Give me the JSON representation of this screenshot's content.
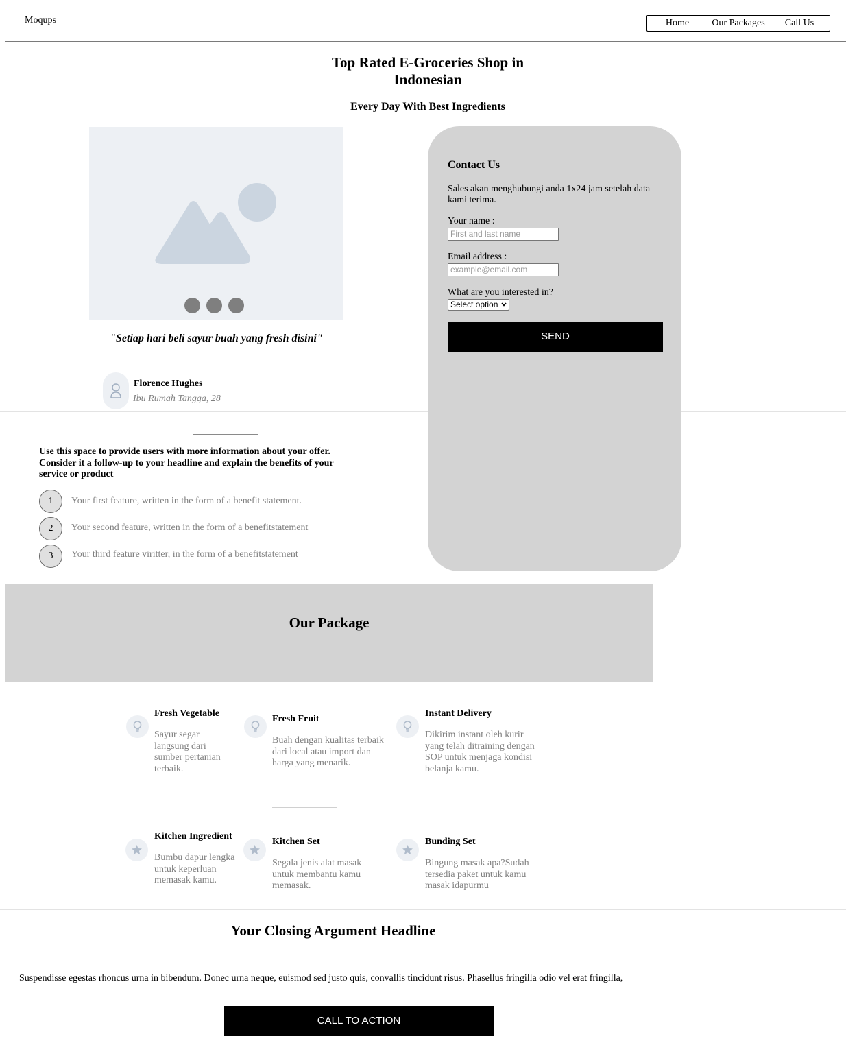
{
  "header": {
    "logo": "Moqups",
    "nav": [
      "Home",
      "Our Packages",
      "Call Us"
    ]
  },
  "hero": {
    "title_line1": "Top Rated E-Groceries Shop in",
    "title_line2": "Indonesian",
    "subtitle": "Every Day With Best Ingredients"
  },
  "testimonial": {
    "image_icon": "image-placeholder-icon",
    "quote": "\"Setiap hari beli sayur buah yang fresh disini\"",
    "name": "Florence Hughes",
    "role": "Ibu Rumah Tangga, 28",
    "avatar_icon": "user-icon"
  },
  "offer": {
    "text": "Use this space to provide users with more information about your offer. Consider it a follow-up to your headline and explain the benefits of your service or product",
    "features": [
      {
        "num": "1",
        "text": "Your first feature, written in the form of a benefit statement."
      },
      {
        "num": "2",
        "text": "Your second feature, written in the form of a benefitstatement"
      },
      {
        "num": "3",
        "text": "Your third feature viritter, in the form of a benefitstatement"
      }
    ]
  },
  "contact": {
    "title": "Contact Us",
    "desc": "Sales akan menghubungi anda 1x24 jam setelah data kami terima.",
    "name_label": "Your name :",
    "name_placeholder": "First and last name",
    "email_label": "Email address :",
    "email_placeholder": "example@email.com",
    "interest_label": "What are you interested in?",
    "interest_selected": "Select option",
    "send": "SEND"
  },
  "packages": {
    "title": "Our Package",
    "row1_icon": "lightbulb-icon",
    "row2_icon": "star-icon",
    "items": [
      {
        "title": "Fresh Vegetable",
        "desc": "Sayur segar langsung dari sumber pertanian terbaik."
      },
      {
        "title": "Fresh Fruit",
        "desc": "Buah dengan kualitas terbaik dari local atau import dan harga yang menarik."
      },
      {
        "title": "Instant Delivery",
        "desc": "Dikirim instant oleh kurir yang telah ditraining dengan SOP untuk menjaga kondisi belanja kamu."
      },
      {
        "title": "Kitchen Ingredient",
        "desc": "Bumbu dapur lengka untuk keperluan memasak kamu."
      },
      {
        "title": "Kitchen Set",
        "desc": "Segala jenis alat masak untuk membantu kamu memasak."
      },
      {
        "title": "Bunding Set",
        "desc": "Bingung masak apa?Sudah tersedia paket untuk kamu masak idapurmu"
      }
    ]
  },
  "closing": {
    "title": "Your Closing Argument Headline",
    "text": "Suspendisse egestas rhoncus urna in bibendum. Donec urna neque, euismod sed justo quis, convallis tincidunt risus. Phasellus fringilla odio vel erat fringilla,",
    "cta": "CALL TO ACTION"
  },
  "colors": {
    "card_bg": "#d3d3d3",
    "placeholder_bg": "#edf0f4",
    "placeholder_shape": "#cbd5e0",
    "button_bg": "#000000",
    "muted_text": "#808080"
  }
}
